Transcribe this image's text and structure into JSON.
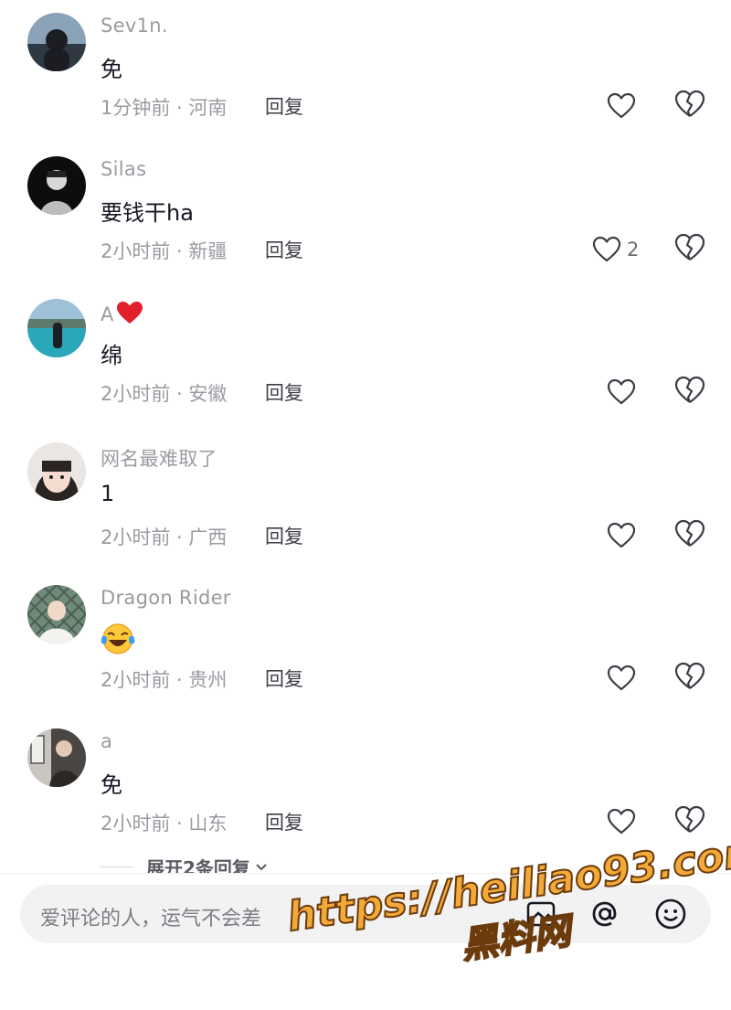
{
  "comments": [
    {
      "username": "Sev1n.",
      "text": "免",
      "time": "1分钟前",
      "location": "河南",
      "reply": "回复",
      "likes": "",
      "avatar": "avatar-landscape"
    },
    {
      "username": "Silas",
      "text": "要钱干ha",
      "time": "2小时前",
      "location": "新疆",
      "reply": "回复",
      "likes": "2",
      "avatar": "avatar-dark-portrait"
    },
    {
      "username": "A",
      "username_heart": true,
      "text": "绵",
      "time": "2小时前",
      "location": "安徽",
      "reply": "回复",
      "likes": "",
      "avatar": "avatar-lake"
    },
    {
      "username": "网名最难取了",
      "text": "1",
      "time": "2小时前",
      "location": "广西",
      "reply": "回复",
      "likes": "",
      "avatar": "avatar-girl"
    },
    {
      "username": "Dragon Rider",
      "text": "",
      "text_emoji": "laugh-cry-emoji",
      "time": "2小时前",
      "location": "贵州",
      "reply": "回复",
      "likes": "",
      "avatar": "avatar-fence"
    },
    {
      "username": "a",
      "text": "免",
      "time": "2小时前",
      "location": "山东",
      "reply": "回复",
      "likes": "",
      "avatar": "avatar-door"
    }
  ],
  "meta_separator": " · ",
  "expand_replies": "展开2条回复",
  "input": {
    "placeholder": "爱评论的人，运气不会差"
  },
  "icons": [
    "heart-icon",
    "broken-heart-icon",
    "image-icon",
    "at-icon",
    "smile-icon",
    "chevron-down-icon"
  ],
  "watermark": {
    "line1": "https://heiliao93.com",
    "line2": "黑料网"
  },
  "colors": {
    "secondary_text": "#9a9ba1",
    "primary_text": "#161823",
    "input_bg": "#f2f2f3",
    "watermark": "#f3a93a"
  }
}
